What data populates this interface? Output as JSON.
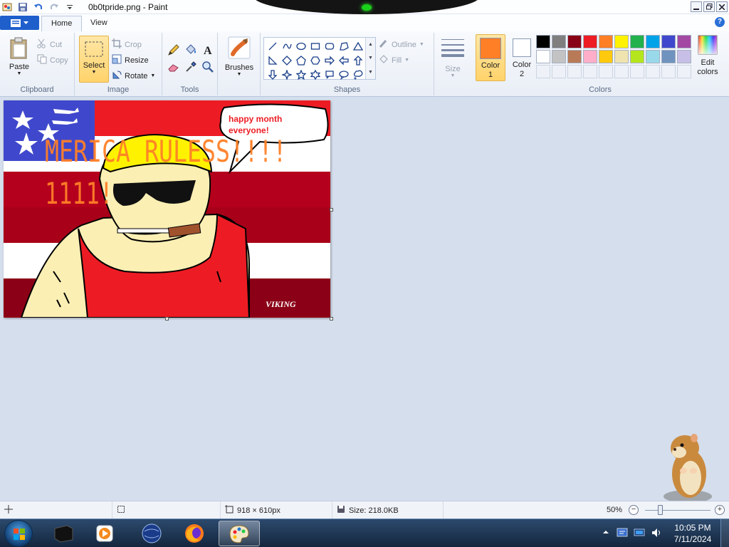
{
  "window": {
    "title": "0b0tpride.png - Paint"
  },
  "ribbon_tabs": [
    {
      "label": "Home"
    },
    {
      "label": "View"
    }
  ],
  "clipboard": {
    "group_label": "Clipboard",
    "paste": "Paste",
    "cut": "Cut",
    "copy": "Copy"
  },
  "image_group": {
    "group_label": "Image",
    "select": "Select",
    "crop": "Crop",
    "resize": "Resize",
    "rotate": "Rotate"
  },
  "tools_group": {
    "group_label": "Tools"
  },
  "brushes": {
    "label": "Brushes"
  },
  "shapes_group": {
    "group_label": "Shapes",
    "outline": "Outline",
    "fill": "Fill",
    "shapes": [
      "line-icon",
      "curve-icon",
      "oval-icon",
      "rectangle-icon",
      "rounded-rectangle-icon",
      "polygon-icon",
      "triangle-icon",
      "right-triangle-icon",
      "diamond-icon",
      "pentagon-icon",
      "hexagon-icon",
      "right-arrow-icon",
      "left-arrow-icon",
      "up-arrow-icon",
      "down-arrow-icon",
      "four-point-star-icon",
      "five-point-star-icon",
      "six-point-star-icon",
      "rounded-callout-icon",
      "oval-callout-icon",
      "cloud-callout-icon"
    ]
  },
  "size": {
    "label": "Size"
  },
  "colors_group": {
    "group_label": "Colors",
    "color1_label": "Color 1",
    "color2_label": "Color 2",
    "color1": "#ff7f27",
    "color2": "#ffffff",
    "edit_colors": "Edit colors",
    "palette": [
      "#000000",
      "#7f7f7f",
      "#880015",
      "#ed1c24",
      "#ff7f27",
      "#fff200",
      "#22b14c",
      "#00a2e8",
      "#3f48cc",
      "#a349a4",
      "#ffffff",
      "#c3c3c3",
      "#b97a57",
      "#ffaec9",
      "#ffc90e",
      "#efe4b0",
      "#b5e61d",
      "#99d9ea",
      "#7092be",
      "#c8bfe7"
    ]
  },
  "artwork": {
    "speech_text_line1": "happy month",
    "speech_text_line2": "everyone!",
    "headline": "MERICA RULESS!!!!",
    "subline": "1111!",
    "signature": "VIKING"
  },
  "statusbar": {
    "dimensions": "918 × 610px",
    "file_size": "Size: 218.0KB",
    "zoom": "50%"
  },
  "taskbar": {
    "time": "10:05 PM",
    "date": "7/11/2024"
  }
}
